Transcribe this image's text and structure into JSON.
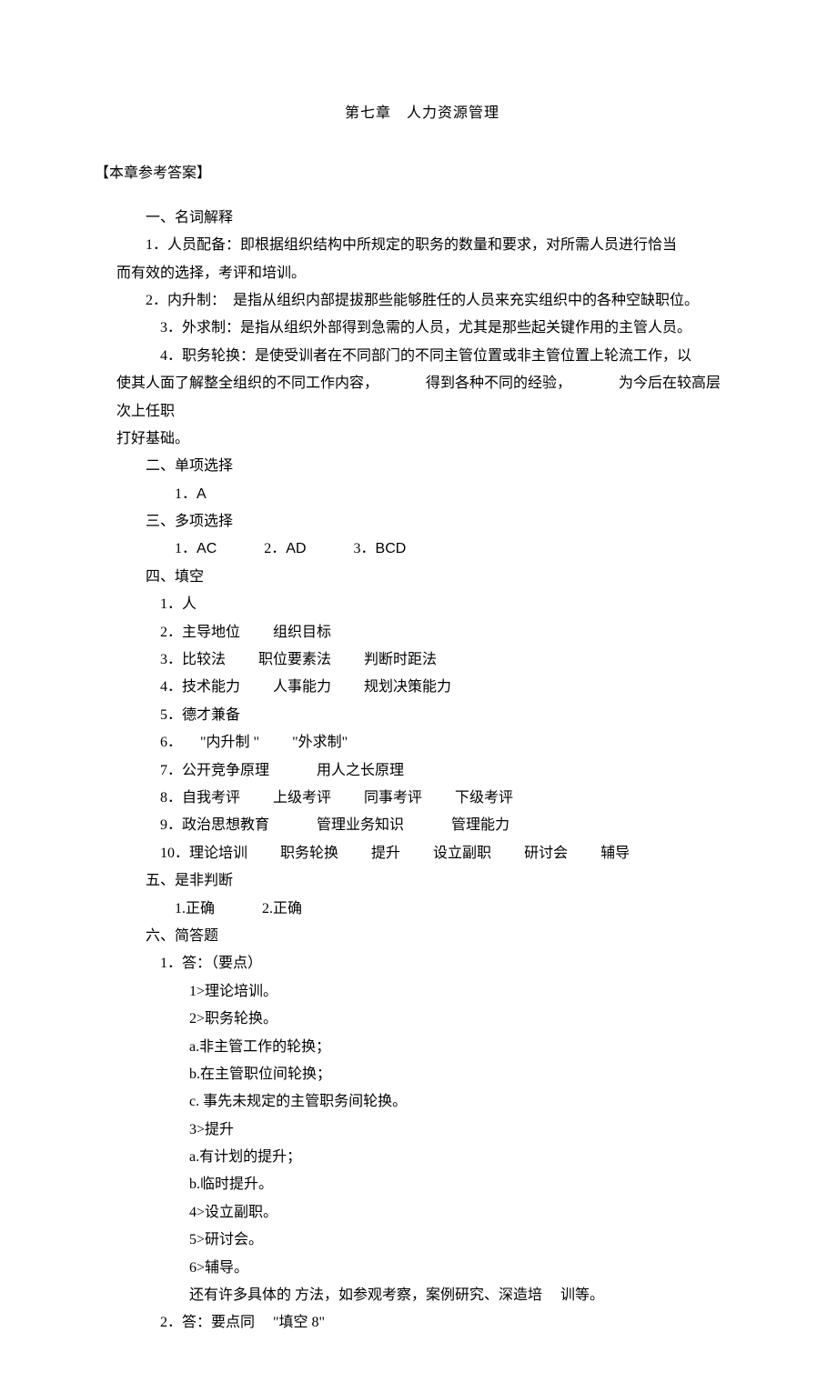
{
  "title": "第七章　人力资源管理",
  "answers_header": "【本章参考答案】",
  "s1": {
    "heading": "一、名词解释",
    "item1_a": "1．人员配备：即根据组织结构中所规定的职务的数量和要求，对所需人员进行恰当",
    "item1_b": "而有效的选择，考评和培训。",
    "item2": "2．内升制：　是指从组织内部提拔那些能够胜任的人员来充实组织中的各种空缺职位。",
    "item3": "3．外求制：是指从组织外部得到急需的人员，尤其是那些起关键作用的主管人员。",
    "item4_a": "4．职务轮换：是使受训者在不同部门的不同主管位置或非主管位置上轮流工作，以",
    "item4_b_1": "使其人面了解整全组织的不同工作内容，",
    "item4_b_2": "得到各种不同的经验，",
    "item4_b_3": "为今后在较高层次上任职",
    "item4_c": "打好基础。"
  },
  "s2": {
    "heading": "二、单项选择",
    "a1_num": "1．",
    "a1_val": "A"
  },
  "s3": {
    "heading": "三、多项选择",
    "a1_num": "1．",
    "a1_val": "AC",
    "a2_num": "2．",
    "a2_val": "AD",
    "a3_num": "3．",
    "a3_val": "BCD"
  },
  "s4": {
    "heading": "四、填空",
    "i1": "1．人",
    "i2a": "2．主导地位",
    "i2b": "组织目标",
    "i3a": "3．比较法",
    "i3b": "职位要素法",
    "i3c": "判断时距法",
    "i4a": "4．技术能力",
    "i4b": "人事能力",
    "i4c": "规划决策能力",
    "i5": "5．德才兼备",
    "i6a": "6．",
    "i6b": "\"内升制 \"",
    "i6c": "\"外求制\"",
    "i7a": "7．公开竞争原理",
    "i7b": "用人之长原理",
    "i8a": "8．自我考评",
    "i8b": "上级考评",
    "i8c": "同事考评",
    "i8d": "下级考评",
    "i9a": "9．政治思想教育",
    "i9b": "管理业务知识",
    "i9c": "管理能力",
    "i10a": "10．理论培训",
    "i10b": "职务轮换",
    "i10c": "提升",
    "i10d": "设立副职",
    "i10e": "研讨会",
    "i10f": "辅导"
  },
  "s5": {
    "heading": "五、是非判断",
    "a1": "1.正确",
    "a2": "2.正确"
  },
  "s6": {
    "heading": "六、简答题",
    "q1": "1．答：（要点）",
    "q1_1": "1>理论培训。",
    "q1_2": "2>职务轮换。",
    "q1_2a": "a.非主管工作的轮换；",
    "q1_2b": "b.在主管职位间轮换；",
    "q1_2c": "c. 事先未规定的主管职务间轮换。",
    "q1_3": "3>提升",
    "q1_3a": "a.有计划的提升；",
    "q1_3b": "b.临时提升。",
    "q1_4": "4>设立副职。",
    "q1_5": "5>研讨会。",
    "q1_6": "6>辅导。",
    "q1_tail_a": "还有许多具体的 方法，如参观考察，案例研究、深造培",
    "q1_tail_b": "训等。",
    "q2_a": "2．答：要点同",
    "q2_b": "\"填空 8\""
  }
}
